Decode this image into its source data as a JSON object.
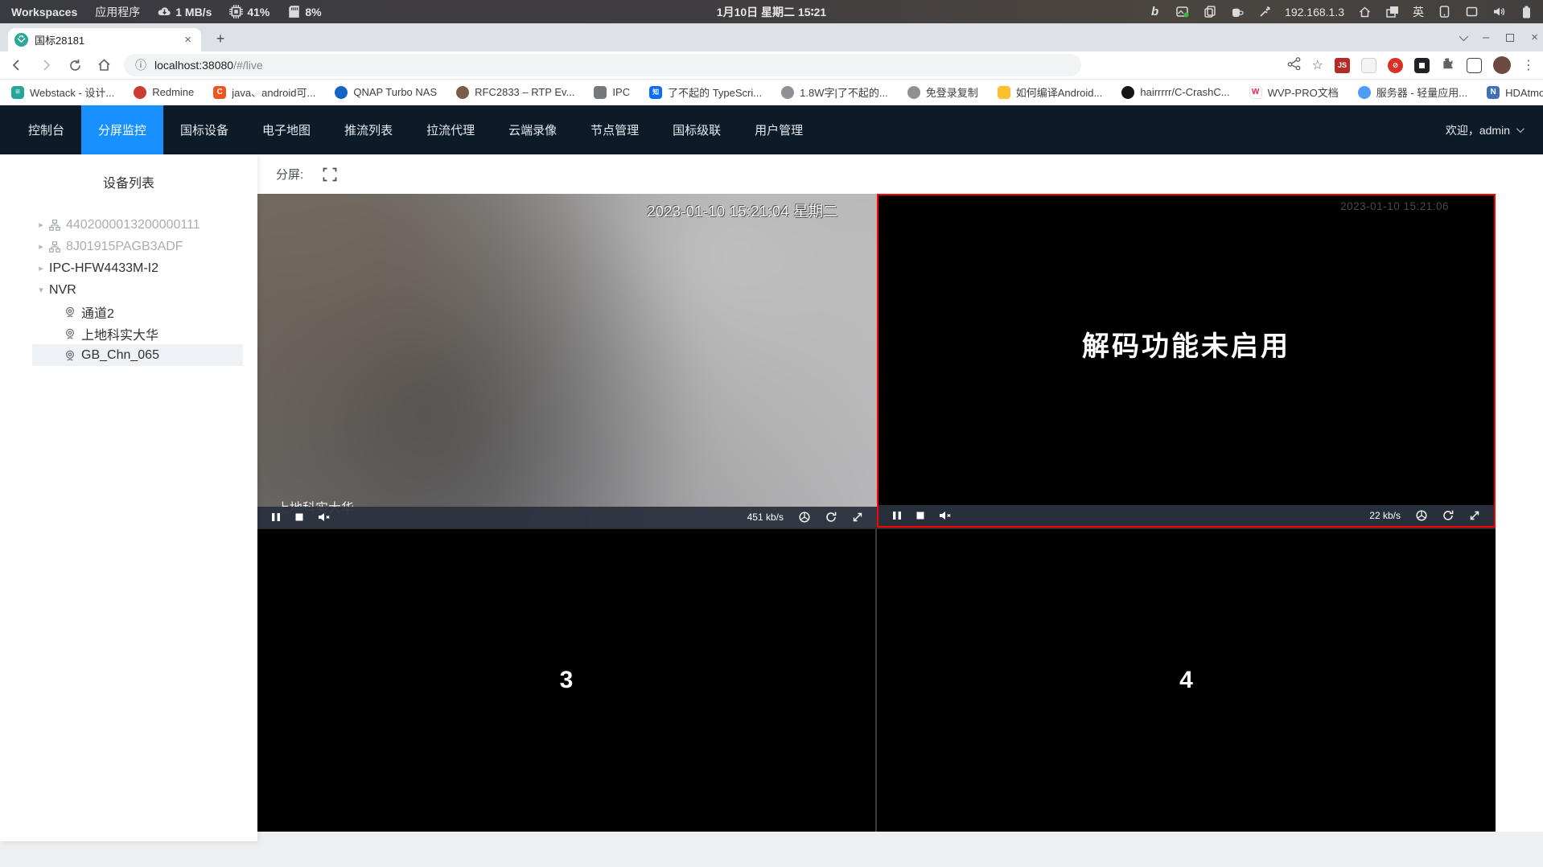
{
  "desktop": {
    "workspaces_label": "Workspaces",
    "apps_label": "应用程序",
    "net_speed": "1 MB/s",
    "cpu_pct": "41%",
    "mem_pct": "8%",
    "clock": "1月10日 星期二 15∶21",
    "ip": "192.168.1.3",
    "ime": "英",
    "bing_glyph": "b"
  },
  "browser": {
    "tab_title": "国标28181",
    "url_host": "localhost:38080",
    "url_path": "/#/live",
    "bookmarks": [
      {
        "label": "Webstack - 设计...",
        "glyph": "≡",
        "style": "background:#26a69a"
      },
      {
        "label": "Redmine",
        "glyph": "",
        "style": "background:#cc3b2f;border-radius:50%"
      },
      {
        "label": "java、android可...",
        "glyph": "C",
        "style": "background:#f05423"
      },
      {
        "label": "QNAP Turbo NAS",
        "glyph": "",
        "style": "background:#1565c0;border-radius:50%"
      },
      {
        "label": "RFC2833 – RTP Ev...",
        "glyph": "",
        "style": "background:#7a5c48;border-radius:50%"
      },
      {
        "label": "IPC",
        "glyph": "",
        "style": "background:#75797e"
      },
      {
        "label": "了不起的 TypeScri...",
        "glyph": "知",
        "style": "background:#0b6cff;font-size:8px"
      },
      {
        "label": "1.8W字|了不起的...",
        "glyph": "",
        "style": "background:#8d9094;border-radius:50%"
      },
      {
        "label": "免登录复制",
        "glyph": "",
        "style": "background:#8d9094;border-radius:50%"
      },
      {
        "label": "如何编译Android...",
        "glyph": "",
        "style": "background:#fbc02d"
      },
      {
        "label": "hairrrrr/C-CrashC...",
        "glyph": "",
        "style": "background:#171515;border-radius:50%"
      },
      {
        "label": "WVP-PRO文档",
        "glyph": "W",
        "style": "background:#fff;color:#e91e63;border:1px solid #e3e3e3"
      },
      {
        "label": "服务器 - 轻量应用...",
        "glyph": "",
        "style": "background:#4f9bf5;border-radius:50%"
      },
      {
        "label": "HDAtmos :: 种子 *...",
        "glyph": "N",
        "style": "background:#3f6fb5"
      }
    ]
  },
  "icons": {
    "close": "×",
    "minus": "–",
    "plus": "+",
    "overflow": "»",
    "menu": "⋮",
    "info": "ⓘ",
    "star": "☆",
    "home": "⌂",
    "caret_right": "▸",
    "caret_down": "▾"
  },
  "app": {
    "nav": {
      "items": [
        "控制台",
        "分屏监控",
        "国标设备",
        "电子地图",
        "推流列表",
        "拉流代理",
        "云端录像",
        "节点管理",
        "国标级联",
        "用户管理"
      ],
      "welcome": "欢迎，admin"
    },
    "sidebar": {
      "title": "设备列表",
      "tree": [
        {
          "label": "4402000013200000111"
        },
        {
          "label": "8J01915PAGB3ADF"
        },
        {
          "label": "IPC-HFW4433M-I2"
        },
        {
          "label": "NVR"
        },
        {
          "label": "通道2"
        },
        {
          "label": "上地科实大华"
        },
        {
          "label": "GB_Chn_065"
        }
      ]
    },
    "toolbar": {
      "split_label": "分屏:"
    },
    "cells": {
      "cell1": {
        "timestamp": "2023-01-10 15:21:04 星期二",
        "camera_label": "上地科实大华",
        "bitrate": "451 kb/s"
      },
      "cell2": {
        "timestamp": "2023-01-10 15:21:06",
        "message": "解码功能未启用",
        "bitrate": "22 kb/s"
      },
      "cell3": {
        "number": "3"
      },
      "cell4": {
        "number": "4"
      }
    },
    "colors": {
      "accent": "#1890ff",
      "selected_border": "#ff0000",
      "nav_bg": "#0d1b29"
    }
  }
}
